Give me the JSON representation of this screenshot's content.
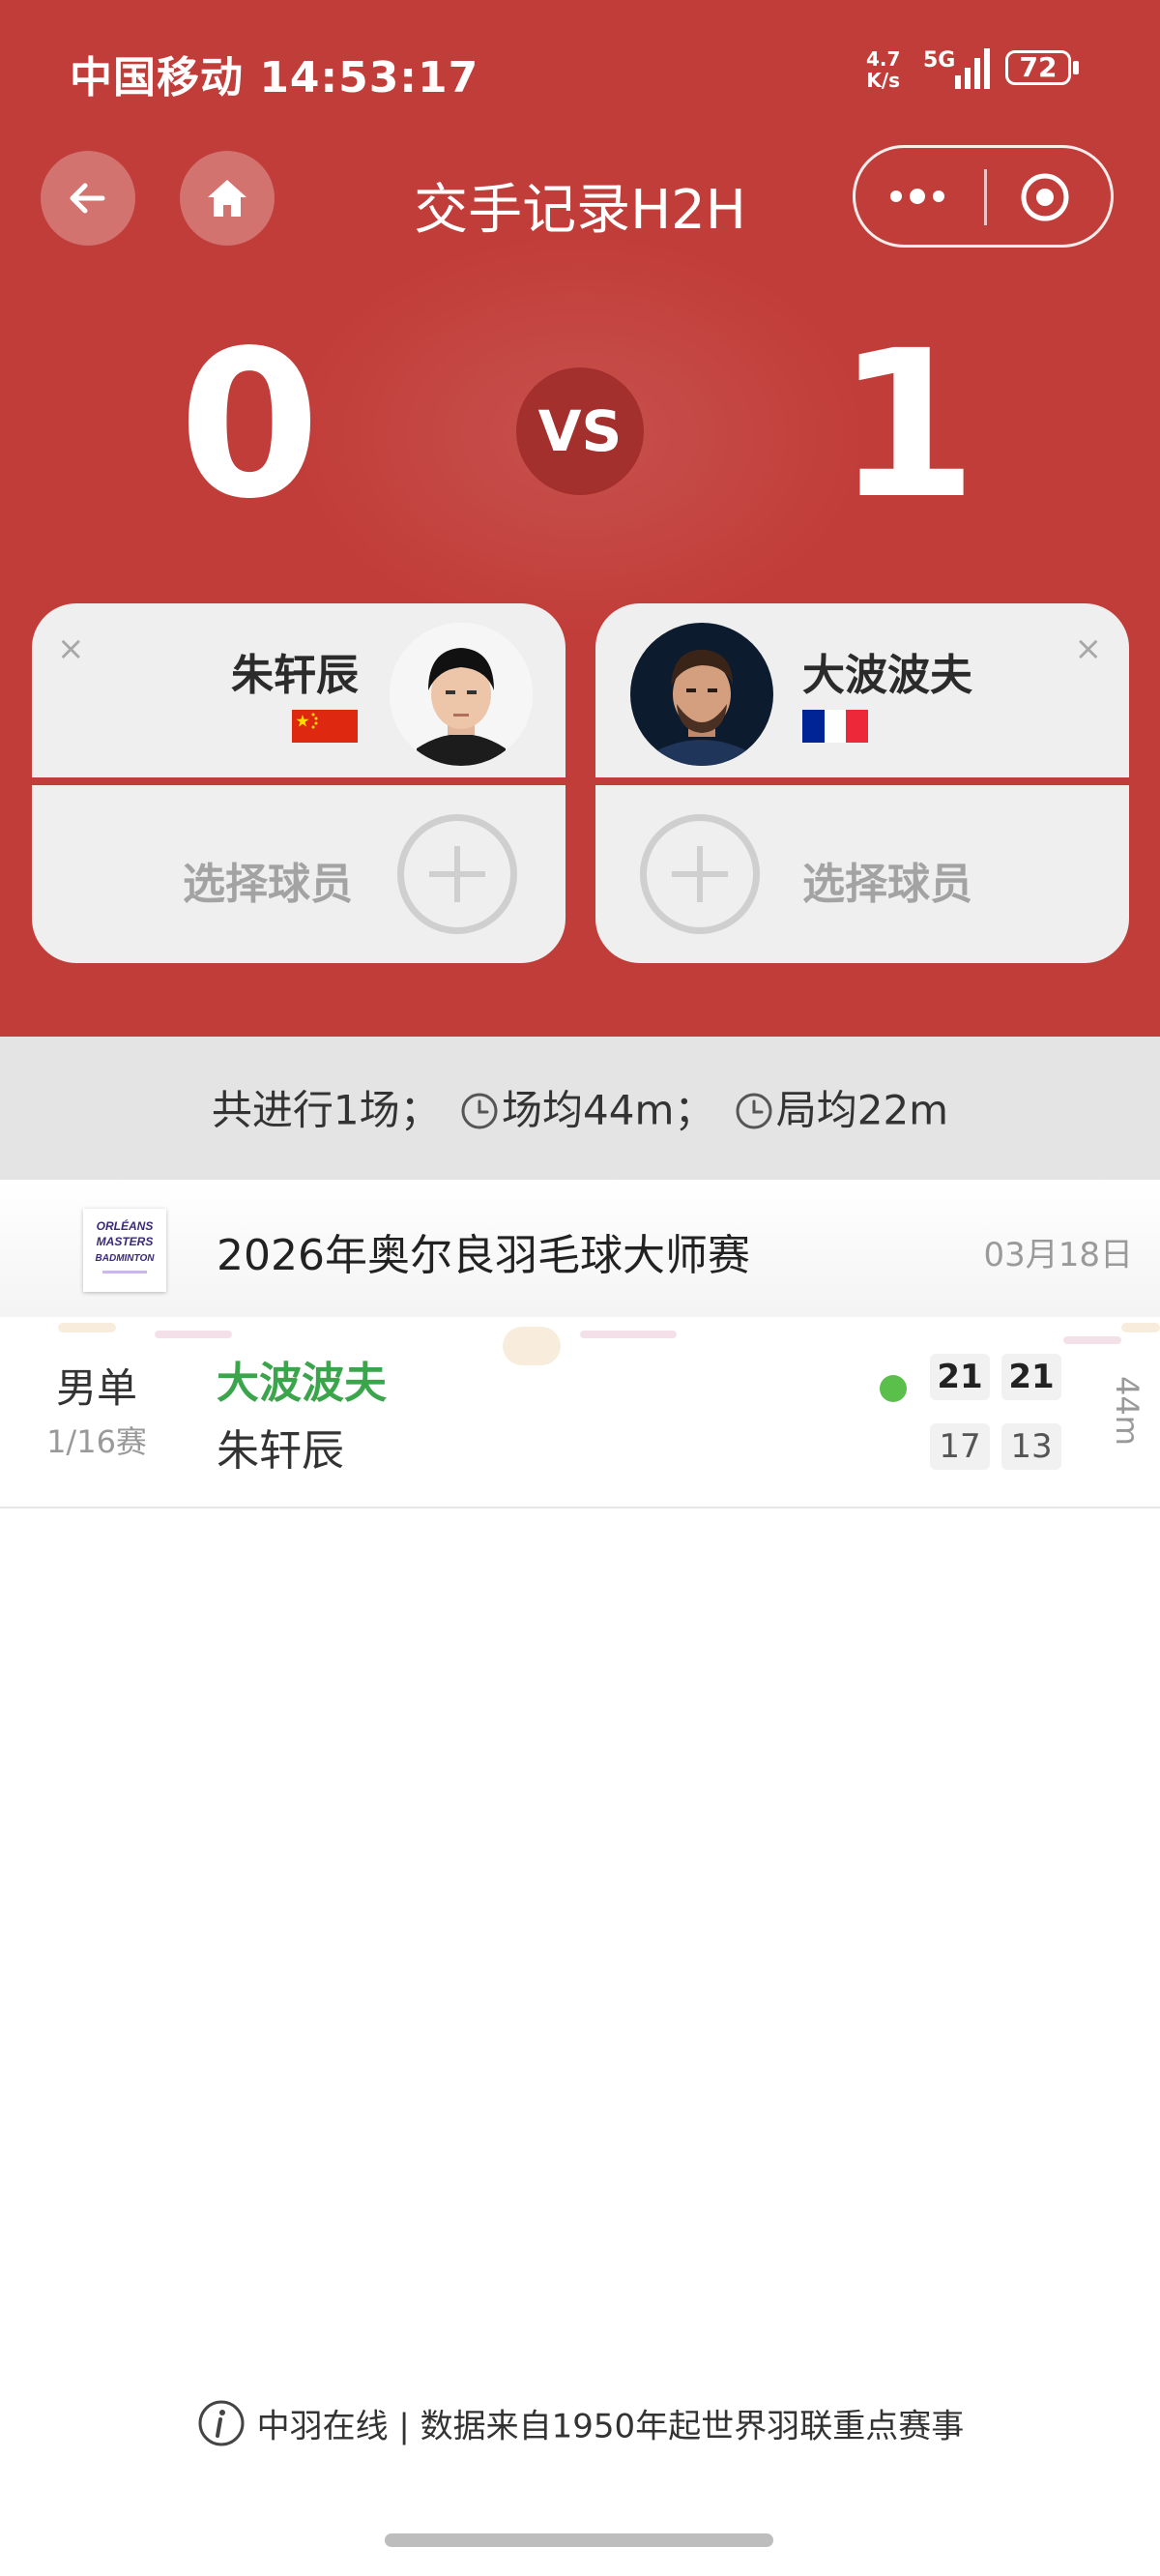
{
  "status_bar": {
    "carrier_time": "中国移动 14:53:17",
    "net_speed_value": "4.7",
    "net_speed_unit": "K/s",
    "network": "5G",
    "battery": "72"
  },
  "nav": {
    "title": "交手记录H2H",
    "back_icon": "arrow-left-icon",
    "home_icon": "home-icon",
    "more_icon": "more-dots-icon",
    "close_icon": "target-circle-icon"
  },
  "scoreboard": {
    "left_score": "0",
    "vs_label": "VS",
    "right_score": "1"
  },
  "players": {
    "left": {
      "name": "朱轩辰",
      "country": "China",
      "flag_icon": "china-flag-icon",
      "remove": "×"
    },
    "right": {
      "name": "大波波夫",
      "country": "France",
      "flag_icon": "france-flag-icon",
      "remove": "×"
    },
    "select_label_left": "选择球员",
    "select_label_right": "选择球员"
  },
  "summary": {
    "total": "共进行1场；",
    "avg_match": "场均44m；",
    "avg_game": "局均22m"
  },
  "event": {
    "name": "2026年奥尔良羽毛球大师赛",
    "date": "03月18日",
    "logo_text": [
      "ORLÉANS",
      "MASTERS",
      "BADMINTON"
    ]
  },
  "match": {
    "type": "男单",
    "round": "1/16赛",
    "winner": "大波波夫",
    "loser": "朱轩辰",
    "winner_scores": [
      "21",
      "21"
    ],
    "loser_scores": [
      "17",
      "13"
    ],
    "duration": "44m"
  },
  "footer": {
    "text": "中羽在线 | 数据来自1950年起世界羽联重点赛事"
  },
  "colors": {
    "header_red": "#c13d39",
    "vs_badge": "#a3302d",
    "winner_green": "#3aa54b"
  }
}
